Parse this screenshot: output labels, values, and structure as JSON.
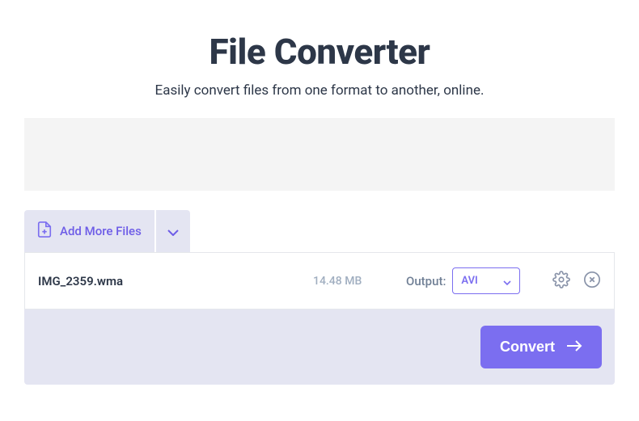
{
  "hero": {
    "title": "File Converter",
    "subtitle": "Easily convert files from one format to another, online."
  },
  "toolbar": {
    "add_more_label": "Add More Files"
  },
  "file": {
    "name": "IMG_2359.wma",
    "size": "14.48 MB",
    "output_label": "Output:",
    "format": "AVI"
  },
  "actions": {
    "convert_label": "Convert"
  }
}
